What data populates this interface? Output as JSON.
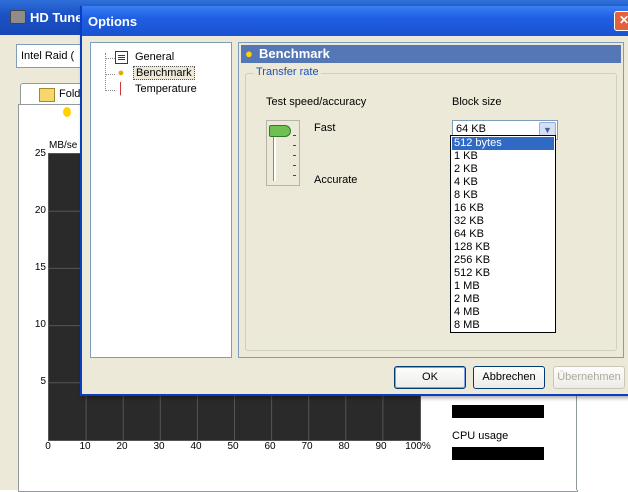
{
  "background_window": {
    "title": "HD Tune",
    "drive_selector": "Intel  Raid (",
    "tab_label": "Fold",
    "chart_unit": "MB/se",
    "y_ticks": [
      "25",
      "20",
      "15",
      "10",
      "5"
    ],
    "x_ticks": [
      "0",
      "10",
      "20",
      "30",
      "40",
      "50",
      "60",
      "70",
      "80",
      "90",
      "100%"
    ],
    "cpu_usage_label": "CPU usage"
  },
  "dialog": {
    "title": "Options",
    "close_glyph": "✕",
    "tree": {
      "items": [
        {
          "label": "General",
          "icon": "document-icon"
        },
        {
          "label": "Benchmark",
          "icon": "lightbulb-icon"
        },
        {
          "label": "Temperature",
          "icon": "thermometer-icon"
        }
      ]
    },
    "header_title": "Benchmark",
    "group_title": "Transfer rate",
    "speed_label": "Test speed/accuracy",
    "fast_label": "Fast",
    "accurate_label": "Accurate",
    "block_size_label": "Block size",
    "block_size_value": "64 KB",
    "block_size_options": [
      "512 bytes",
      "1 KB",
      "2 KB",
      "4 KB",
      "8 KB",
      "16 KB",
      "32 KB",
      "64 KB",
      "128 KB",
      "256 KB",
      "512 KB",
      "1 MB",
      "2 MB",
      "4 MB",
      "8 MB"
    ],
    "highlighted_option": "512 bytes",
    "buttons": {
      "ok": "OK",
      "cancel": "Abbrechen",
      "apply": "Übernehmen"
    }
  },
  "colors": {
    "titlebar": "#1f5ee3",
    "header": "#5577b5",
    "selection": "#316ac5"
  }
}
